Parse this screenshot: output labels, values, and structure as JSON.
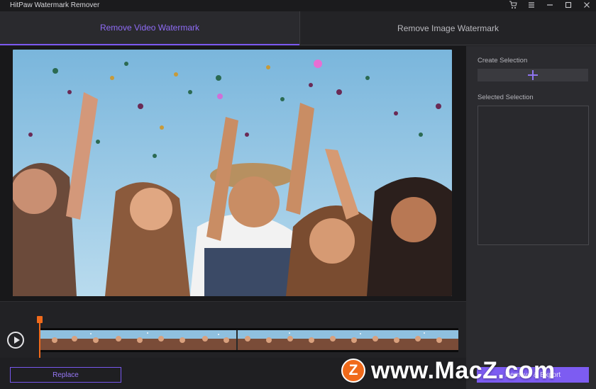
{
  "app": {
    "title": "HitPaw Watermark Remover"
  },
  "window_controls": [
    {
      "name": "cart-icon",
      "glyph": "🛒"
    },
    {
      "name": "menu-icon",
      "glyph": "≡"
    },
    {
      "name": "minimize-icon",
      "glyph": "—"
    },
    {
      "name": "maximize-icon",
      "glyph": "☐"
    },
    {
      "name": "close-icon",
      "glyph": "✕"
    }
  ],
  "tabs": {
    "video": {
      "label": "Remove Video Watermark",
      "active": true
    },
    "image": {
      "label": "Remove Image Watermark",
      "active": false
    }
  },
  "sidebar": {
    "create_selection_label": "Create Selection",
    "add_icon": "plus-icon",
    "selected_selection_label": "Selected Selection"
  },
  "timeline": {
    "play_icon": "play-icon",
    "playhead_position": 0
  },
  "buttons": {
    "replace": "Replace",
    "remove_export": "Remove & Export"
  },
  "watermark": {
    "logo_letter": "Z",
    "text": "www.MacZ.com"
  },
  "colors": {
    "accent": "#7c58f0",
    "playhead": "#f06a1b",
    "background": "#1f1f22"
  }
}
